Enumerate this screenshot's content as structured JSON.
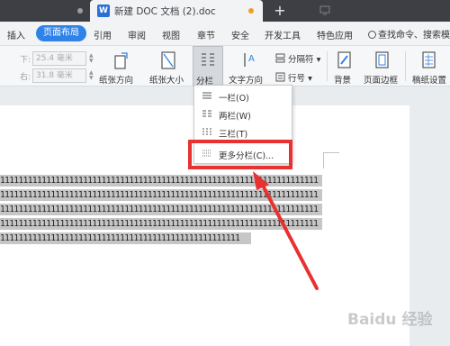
{
  "titlebar": {
    "doc_title": "新建 DOC 文档 (2).doc",
    "new_tab_symbol": "+",
    "doc_icon_letter": "W"
  },
  "menu": {
    "items": [
      "插入",
      "页面布局",
      "引用",
      "审阅",
      "视图",
      "章节",
      "安全",
      "开发工具",
      "特色应用"
    ],
    "active": "页面布局",
    "search_label": "查找命令、搜索模板"
  },
  "ribbon": {
    "margins": [
      {
        "label": "下:",
        "value": "25.4 毫米"
      },
      {
        "label": "右:",
        "value": "31.8 毫米"
      }
    ],
    "buttons": {
      "orientation": "纸张方向",
      "size": "纸张大小",
      "columns": "分栏",
      "text_direction": "文字方向",
      "breaks": "分隔符",
      "line_numbers": "行号",
      "background": "背景",
      "page_border": "页面边框",
      "paper_settings": "稿纸设置"
    }
  },
  "dropdown": {
    "items": [
      "一栏(O)",
      "两栏(W)",
      "三栏(T)",
      "更多分栏(C)..."
    ]
  },
  "document": {
    "lines": [
      "111111111111111111111111111111111111111111111111111111111111111111111",
      "111111111111111111111111111111111111111111111111111111111111111111111",
      "111111111111111111111111111111111111111111111111111111111111111111111",
      "111111111111111111111111111111111111111111111111111111111111111111111",
      "1111111111111111111111111111111111111111111111111111"
    ]
  },
  "watermark": "Baidu 经验",
  "colors": {
    "accent": "#2f82e8",
    "highlight": "#e8322f",
    "selection": "#c6c6c6"
  }
}
